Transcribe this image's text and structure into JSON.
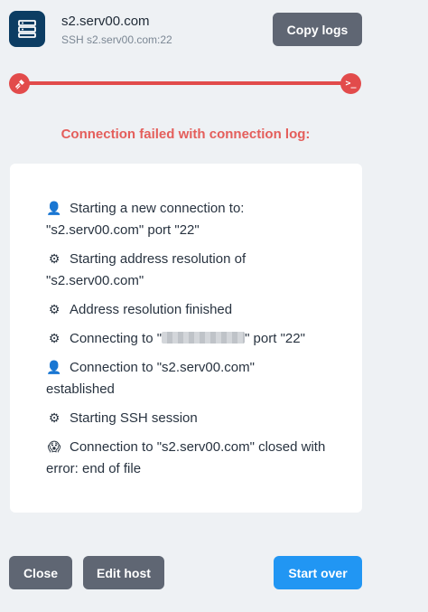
{
  "header": {
    "host_name": "s2.serv00.com",
    "host_subtitle": "SSH s2.serv00.com:22",
    "copy_logs_label": "Copy logs"
  },
  "progress": {
    "start_icon": "plug-icon",
    "end_icon": "terminal-icon",
    "end_symbol": ">_",
    "color": "#e24b4b"
  },
  "status": {
    "title": "Connection failed with connection log:",
    "color": "#e45e5b"
  },
  "log": [
    {
      "icon": "user-icon",
      "glyph": "👤",
      "text": "Starting a new connection to: \"s2.serv00.com\" port \"22\""
    },
    {
      "icon": "gear-icon",
      "glyph": "⚙",
      "text": "Starting address resolution of \"s2.serv00.com\""
    },
    {
      "icon": "gear-icon",
      "glyph": "⚙",
      "text": "Address resolution finished"
    },
    {
      "icon": "gear-icon",
      "glyph": "⚙",
      "text_before": "Connecting to \"",
      "text_after": "\" port \"22\"",
      "redacted": true
    },
    {
      "icon": "user-icon",
      "glyph": "👤",
      "text": "Connection to \"s2.serv00.com\" established"
    },
    {
      "icon": "gear-icon",
      "glyph": "⚙",
      "text": "Starting SSH session"
    },
    {
      "icon": "scared-face-icon",
      "glyph": "😱",
      "text": "Connection to \"s2.serv00.com\" closed with error: end of file"
    }
  ],
  "footer": {
    "close_label": "Close",
    "edit_host_label": "Edit host",
    "start_over_label": "Start over"
  },
  "colors": {
    "background": "#eef1f4",
    "secondary_button": "#5f6673",
    "primary_button": "#2196f3",
    "host_icon": "#0c3d63"
  }
}
